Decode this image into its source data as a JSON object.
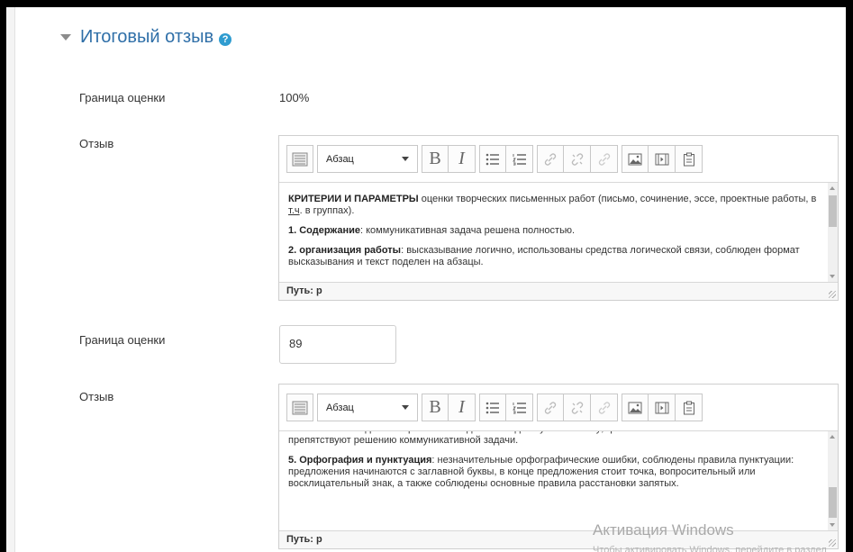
{
  "section": {
    "title": "Итоговый отзыв",
    "help_icon": "?"
  },
  "labels": {
    "grade_boundary": "Граница оценки",
    "feedback": "Отзыв"
  },
  "boundary1": {
    "value": "100%"
  },
  "boundary2": {
    "value": "89"
  },
  "toolbar": {
    "paragraph_select": "Абзац",
    "bold": "B",
    "italic": "I",
    "icons": [
      "toolbar-toggle-icon",
      "bullet-list-icon",
      "numbered-list-icon",
      "link-icon",
      "unlink-icon",
      "nolink-icon",
      "image-icon",
      "media-icon",
      "paste-icon"
    ]
  },
  "editor1": {
    "p1_bold": "КРИТЕРИИ И ПАРАМЕТРЫ",
    "p1_text_a": " оценки творческих письменных работ (письмо,  сочинение, эссе, проектные работы, в ",
    "p1_abbr": "т.ч",
    "p1_text_b": ". в группах).",
    "p2_bold": "1. Содержание",
    "p2_text": ": коммуникативная задача решена полностью.",
    "p3_bold": "2. организация работы",
    "p3_text": ": высказывание логично, использованы средства логической связи, соблюден формат высказывания и текст поделен на абзацы.",
    "path": "Путь: p"
  },
  "editor2": {
    "p1_text": "поставленной задачей и требованиям данного года обучения языку; грамматические ошибки незначительно препятствуют решению коммуникативной задачи.",
    "p2_bold": "5. Орфография и пунктуация",
    "p2_text": ": незначительные орфографические ошибки, соблюдены правила пунктуации: предложения начинаются с заглавной буквы, в конце предложения стоит точка, вопросительный или восклицательный знак, а также соблюдены основные правила расстановки запятых.",
    "path": "Путь: p"
  },
  "watermark": {
    "title": "Активация Windows",
    "subtitle": "Чтобы активировать Windows, перейдите в раздел"
  },
  "colors": {
    "accent": "#2f6fa8",
    "help": "#2f9cd0",
    "border": "#cfcfcf"
  }
}
